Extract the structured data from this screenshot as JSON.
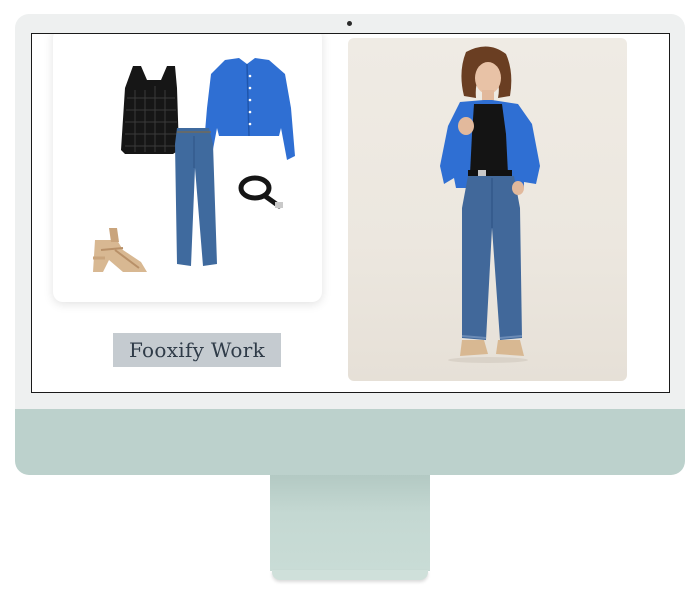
{
  "screen": {
    "caption": "Fooxify Work"
  },
  "icons": {
    "camera": "camera-dot",
    "tank_top": "black-crochet-tank-icon",
    "cardigan": "blue-cardigan-icon",
    "jeans": "straight-jeans-icon",
    "belt": "black-belt-icon",
    "sandals": "tan-platform-sandals-icon"
  },
  "colors": {
    "monitor_chin": "#bcd1cc",
    "cardigan_blue": "#2f6fd3",
    "denim": "#3f6a9e",
    "caption_bg": "#c5cbd0",
    "caption_text": "#2f3b48"
  }
}
